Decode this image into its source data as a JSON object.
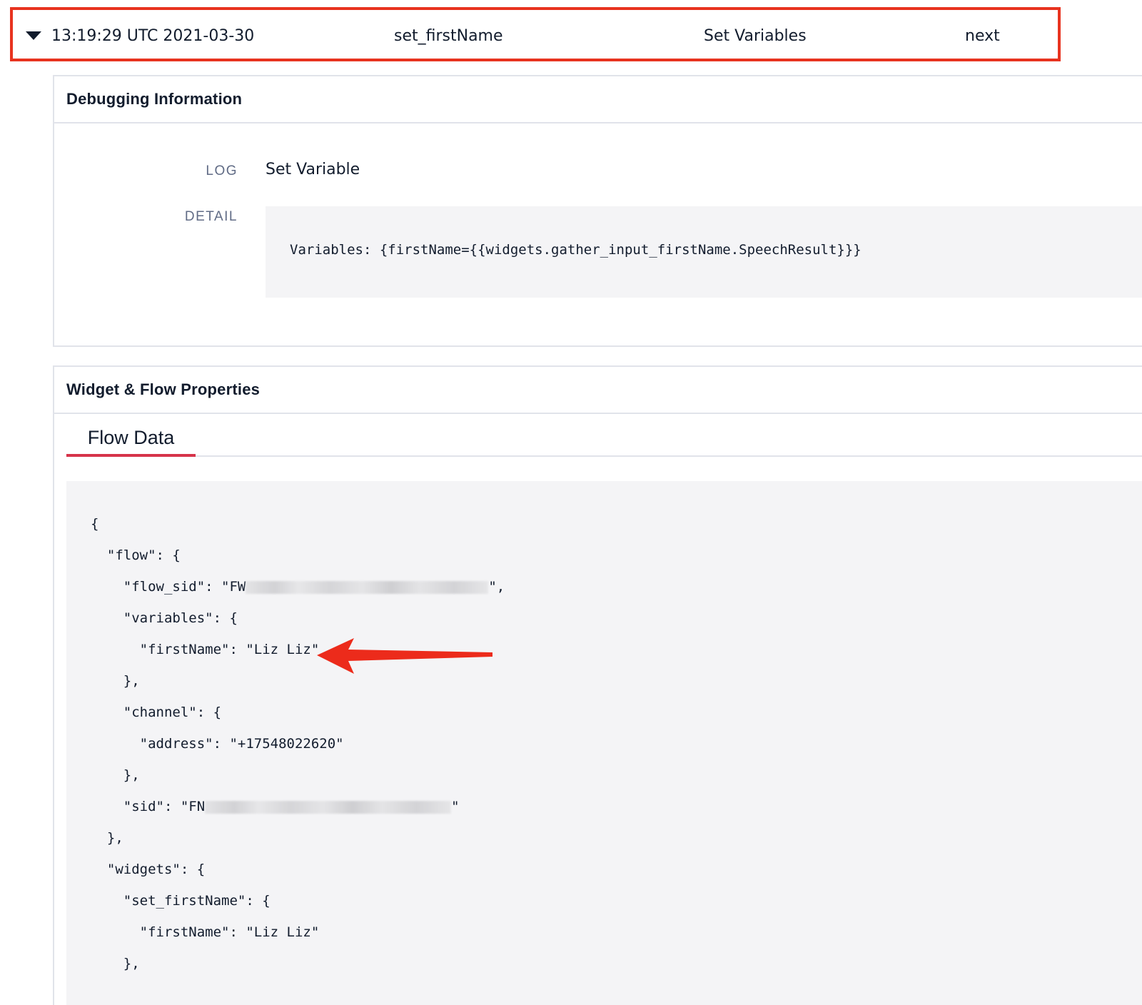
{
  "event_row": {
    "timestamp": "13:19:29 UTC 2021-03-30",
    "widget": "set_firstName",
    "widget_type": "Set Variables",
    "event": "next"
  },
  "debugging": {
    "title": "Debugging Information",
    "log_label": "LOG",
    "log_value": "Set Variable",
    "detail_label": "DETAIL",
    "detail_value": "Variables: {firstName={{widgets.gather_input_firstName.SpeechResult}}}"
  },
  "properties": {
    "title": "Widget & Flow Properties",
    "tabs": [
      {
        "label": "Flow Data",
        "active": true
      }
    ],
    "json_lines": [
      "{",
      "  \"flow\": {",
      "    \"flow_sid\": \"FW",
      "    \"variables\": {",
      "      \"firstName\": \"Liz Liz\"",
      "    },",
      "    \"channel\": {",
      "      \"address\": \"+17548022620\"",
      "    },",
      "    \"sid\": \"FN",
      "  },",
      "  \"widgets\": {",
      "    \"set_firstName\": {",
      "      \"firstName\": \"Liz Liz\"",
      "    },"
    ],
    "flow_sid_suffix": "\",",
    "sid_suffix": "\""
  },
  "colors": {
    "highlight_border": "#e8331f",
    "tab_accent": "#d6334a",
    "annotation_arrow": "#ec2b1b",
    "code_background": "#f4f4f6"
  }
}
